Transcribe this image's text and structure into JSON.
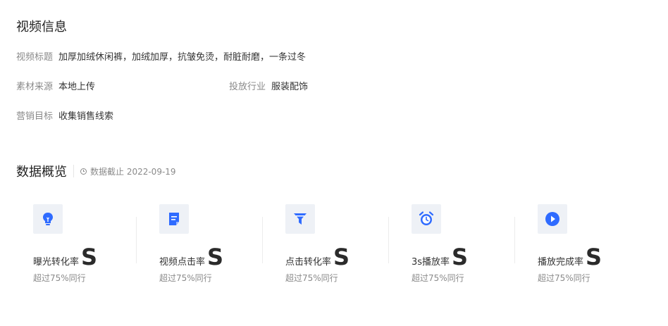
{
  "video_info": {
    "title": "视频信息",
    "fields": {
      "video_title": {
        "label": "视频标题",
        "value": "加厚加绒休闲裤，加绒加厚，抗皱免烫，耐脏耐磨，一条过冬"
      },
      "material_source": {
        "label": "素材来源",
        "value": "本地上传"
      },
      "industry": {
        "label": "投放行业",
        "value": "服装配饰"
      },
      "marketing_goal": {
        "label": "营销目标",
        "value": "收集销售线索"
      }
    }
  },
  "overview": {
    "title": "数据概览",
    "cutoff_text": "数据截止 2022-09-19",
    "accent_color": "#2f6bff",
    "metrics": [
      {
        "icon": "lightbulb-icon",
        "label": "曝光转化率",
        "grade": "S",
        "sub": "超过75%同行"
      },
      {
        "icon": "document-icon",
        "label": "视频点击率",
        "grade": "S",
        "sub": "超过75%同行"
      },
      {
        "icon": "funnel-icon",
        "label": "点击转化率",
        "grade": "S",
        "sub": "超过75%同行"
      },
      {
        "icon": "alarm-clock-icon",
        "label": "3s播放率",
        "grade": "S",
        "sub": "超过75%同行"
      },
      {
        "icon": "play-icon",
        "label": "播放完成率",
        "grade": "S",
        "sub": "超过75%同行"
      }
    ]
  }
}
